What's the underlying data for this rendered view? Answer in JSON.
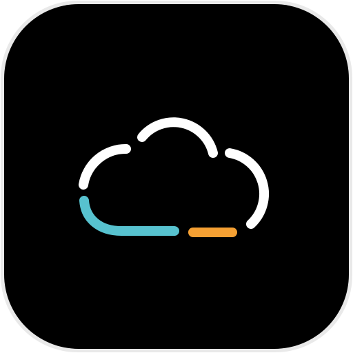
{
  "icon": {
    "name": "cloud-app-icon",
    "colors": {
      "background": "#000000",
      "tile_edge": "#e9e9e9",
      "cloud_outline": "#ffffff",
      "baseline_left": "#57c2cf",
      "baseline_right": "#f5a033"
    }
  }
}
